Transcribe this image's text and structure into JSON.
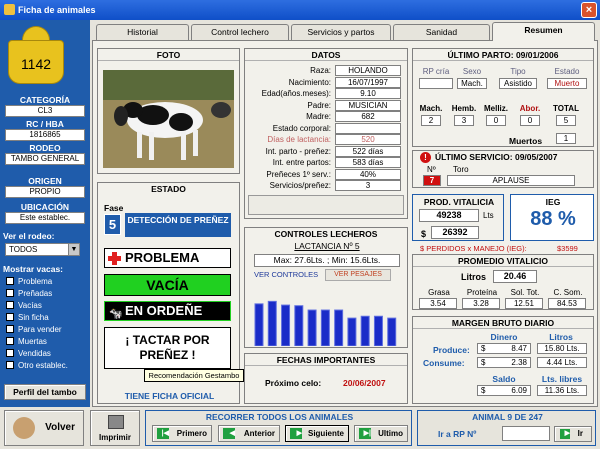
{
  "window": {
    "title": "Ficha de animales"
  },
  "left": {
    "tag_number": "1142",
    "categoria_label": "CATEGORÍA",
    "categoria_value": "CL3",
    "rc_label": "RC / HBA",
    "rc_value": "1816865",
    "rodeo_label": "RODEO",
    "rodeo_value": "TAMBO GENERAL",
    "origen_label": "ORIGEN",
    "origen_value": "PROPIO",
    "ubicacion_label": "UBICACIÓN",
    "ubicacion_value": "Este establec.",
    "rodeo_filter_label": "Ver el rodeo:",
    "rodeo_filter_value": "TODOS",
    "mostrar_label": "Mostrar vacas:",
    "checkboxes": [
      "Problema",
      "Preñadas",
      "Vacías",
      "Sin ficha",
      "Para vender",
      "Muertas",
      "Vendidas",
      "Otro establec."
    ],
    "perfil_button": "Perfil del tambo"
  },
  "tabs": [
    "Historial",
    "Control lechero",
    "Servicios y partos",
    "Sanidad",
    "Resumen"
  ],
  "foto": {
    "title": "FOTO"
  },
  "estado": {
    "title": "ESTADO",
    "fase_label": "Fase",
    "fase_value": "5",
    "fase_text": "DETECCIÓN DE PREÑEZ",
    "problema": "PROBLEMA",
    "vacia": "VACÍA",
    "ordene": "EN ORDEÑE",
    "tactar": "¡ TACTAR POR PREÑEZ !",
    "tooltip": "Recomendación Gestambo",
    "ficha": "TIENE FICHA OFICIAL"
  },
  "datos": {
    "title": "DATOS",
    "rows": [
      {
        "label": "Raza:",
        "value": "HOLANDO"
      },
      {
        "label": "Nacimiento:",
        "value": "16/07/1997"
      },
      {
        "label": "Edad(años.meses):",
        "value": "9.10"
      },
      {
        "label": "Padre:",
        "value": "MUSICIAN"
      },
      {
        "label": "Madre:",
        "value": "682"
      },
      {
        "label": "Estado corporal:",
        "value": ""
      },
      {
        "label": "Días de lactancia:",
        "value": "520"
      },
      {
        "label": "Int. parto - preñez:",
        "value": "522 días"
      },
      {
        "label": "Int. entre partos:",
        "value": "583 días"
      },
      {
        "label": "Preñeces 1º serv.:",
        "value": "40%"
      },
      {
        "label": "Servicios/preñez:",
        "value": "3"
      }
    ]
  },
  "controles": {
    "title": "CONTROLES LECHEROS",
    "lactancia": "LACTANCIA Nº 5",
    "maxmin": "Max: 27.6Lts. ; Min: 15.6Lts.",
    "ver_controles": "VER CONTROLES",
    "ver_pesajes": "VER PESAJES",
    "bars": [
      0.68,
      0.72,
      0.66,
      0.65,
      0.58,
      0.58,
      0.58,
      0.45,
      0.48,
      0.48,
      0.45
    ]
  },
  "fechas": {
    "title": "FECHAS IMPORTANTES",
    "label": "Próximo celo:",
    "value": "20/06/2007"
  },
  "parto": {
    "title": "ÚLTIMO PARTO: 09/01/2006",
    "h_rp": "RP cría",
    "h_sexo": "Sexo",
    "h_tipo": "Tipo",
    "h_estado": "Estado",
    "rp": "",
    "sexo": "Mach.",
    "tipo": "Asistido",
    "estado": "Muerto",
    "h_mach": "Mach.",
    "h_hemb": "Hemb.",
    "h_melliz": "Melliz.",
    "h_abor": "Abor.",
    "h_total": "TOTAL",
    "mach": "2",
    "hemb": "3",
    "melliz": "0",
    "abor": "0",
    "total": "5",
    "muertos_label": "Muertos",
    "muertos": "1"
  },
  "servicio": {
    "title": "ÚLTIMO SERVICIO: 09/05/2007",
    "h_n": "Nº",
    "h_toro": "Toro",
    "n": "7",
    "toro": "APLAUSE"
  },
  "prod": {
    "title": "PROD. VITALICIA",
    "lts": "49238",
    "lts_unit": "Lts",
    "money_sym": "$",
    "money": "26392",
    "ieg_title": "IEG",
    "ieg_value": "88 %",
    "perdidos": "$ PERDIDOS x MANEJO (IEG):",
    "perdidos_value": "$3599"
  },
  "promedio": {
    "title": "PROMEDIO VITALICIO",
    "litros_label": "Litros",
    "litros": "20.46",
    "h": [
      "Grasa",
      "Proteína",
      "Sol. Tot.",
      "C. Som."
    ],
    "v": [
      "3.54",
      "3.28",
      "12.51",
      "84.53"
    ]
  },
  "margen": {
    "title": "MARGEN BRUTO DIARIO",
    "h_dinero": "Dinero",
    "h_litros": "Litros",
    "produce_label": "Produce:",
    "consume_label": "Consume:",
    "produce_d": "8.47",
    "produce_l": "15.80 Lts.",
    "consume_d": "2.38",
    "consume_l": "4.44 Lts.",
    "h_saldo": "Saldo",
    "h_libres": "Lts. libres",
    "saldo": "6.09",
    "libres": "11.36 Lts.",
    "sym": "$"
  },
  "bottom": {
    "volver": "Volver",
    "imprimir": "Imprimir",
    "recorrer": "RECORRER TODOS LOS ANIMALES",
    "primero": "Primero",
    "anterior": "Anterior",
    "siguiente": "Siguiente",
    "ultimo": "Ultimo",
    "animal": "ANIMAL 9 DE 247",
    "ir_rp": "Ir a RP Nº",
    "ir": "Ir"
  },
  "colors": {
    "left_panel": "#1f5cab",
    "accent_blue": "#1f5cab",
    "green": "#20d020",
    "red": "#e02020",
    "bar_blue": "#1a2cc8"
  }
}
